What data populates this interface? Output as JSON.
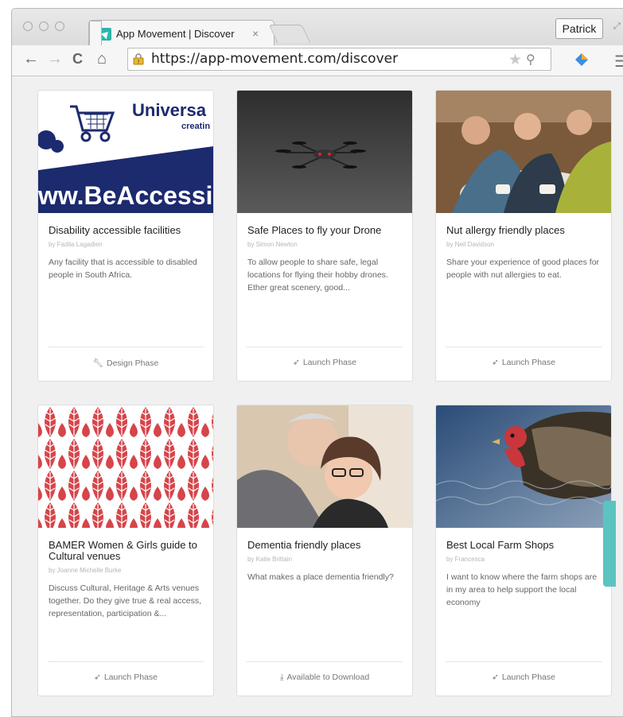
{
  "browser": {
    "tab_title": "App Movement | Discover",
    "tab_close": "×",
    "profile_name": "Patrick",
    "url": "https://app-movement.com/discover",
    "nav": {
      "back": "←",
      "forward": "→",
      "reload": "C",
      "home": "⌂"
    }
  },
  "cards": [
    {
      "title": "Disability accessible facilities",
      "author": "by Fadila Lagadien",
      "description": "Any facility that is accessible to disabled people in South Africa.",
      "phase": "Design Phase",
      "phase_icon": "wrench-icon",
      "image_text": {
        "line1": "Universa",
        "line2": "creatin",
        "line3": "ww.BeAccessibl"
      }
    },
    {
      "title": "Safe Places to fly your Drone",
      "author": "by Simon Newton",
      "description": "To allow people to share safe, legal locations for flying their hobby drones. Ether great scenery, good...",
      "phase": "Launch Phase",
      "phase_icon": "rocket-icon"
    },
    {
      "title": "Nut allergy friendly places",
      "author": "by Neil Davidson",
      "description": "Share your experience of good places for people with nut allergies to eat.",
      "phase": "Launch Phase",
      "phase_icon": "rocket-icon"
    },
    {
      "title": "BAMER Women & Girls guide to Cultural venues",
      "author": "by Joanne Michelle Burke",
      "description": "Discuss Cultural, Heritage & Arts venues together. Do they give true & real access, representation, participation &...",
      "phase": "Launch Phase",
      "phase_icon": "rocket-icon"
    },
    {
      "title": "Dementia friendly places",
      "author": "by Katie Brittain",
      "description": "What makes a place dementia friendly?",
      "phase": "Available to Download",
      "phase_icon": "download-icon"
    },
    {
      "title": "Best Local Farm Shops",
      "author": "by Francesca",
      "description": "I want to know where the farm shops are in my area to help support the local economy",
      "phase": "Launch Phase",
      "phase_icon": "rocket-icon"
    }
  ],
  "colors": {
    "accent": "#2db5ad",
    "page_bg": "#f0f0f0",
    "banner_navy": "#1c2a6e",
    "pattern_red": "#d6454a"
  }
}
